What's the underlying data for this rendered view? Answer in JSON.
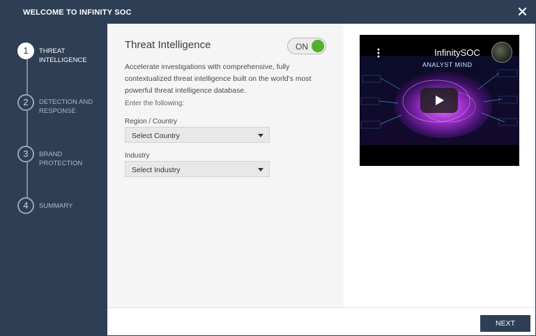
{
  "dialog": {
    "title": "WELCOME TO INFINITY SOC"
  },
  "steps": [
    {
      "number": "1",
      "label": "THREAT INTELLIGENCE",
      "active": true
    },
    {
      "number": "2",
      "label": "DETECTION AND RESPONSE",
      "active": false
    },
    {
      "number": "3",
      "label": "BRAND PROTECTION",
      "active": false
    },
    {
      "number": "4",
      "label": "SUMMARY",
      "active": false
    }
  ],
  "threat_intel": {
    "title": "Threat Intelligence",
    "toggle_label": "ON",
    "description": "Accelerate investigations with comprehensive, fully contextualized threat intelligence built on the world's most powerful threat intelligence database.",
    "instruction": "Enter the following:",
    "region_label": "Region / Country",
    "region_value": "Select Country",
    "industry_label": "Industry",
    "industry_value": "Select Industry"
  },
  "video": {
    "title": "InfinitySOC",
    "subtitle": "ANALYST MIND"
  },
  "footer": {
    "next_label": "NEXT"
  },
  "colors": {
    "sidebar": "#2d3e55",
    "toggle_on": "#4fb12e",
    "content_bg": "#f5f5f5"
  },
  "icons": {
    "close": "close-icon",
    "play": "play-icon",
    "more": "more-vertical-icon",
    "dropdown": "chevron-down-icon"
  }
}
